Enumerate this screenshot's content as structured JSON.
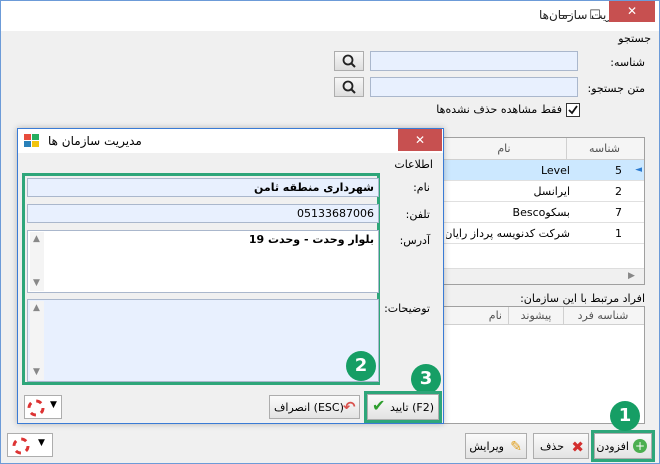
{
  "window": {
    "title": "مدیریت سازمان‌ها"
  },
  "search": {
    "group_title": "جستجو",
    "id_label": "شناسه:",
    "text_label": "متن جستجو:",
    "id_value": "",
    "text_value": "",
    "checkbox_label": "فقط مشاهده حذف نشده‌ها",
    "checkbox_checked": true
  },
  "grid": {
    "columns": {
      "id": "شناسه",
      "name": "نام"
    },
    "rows": [
      {
        "id": "5",
        "name": "Level"
      },
      {
        "id": "2",
        "name": "ایرانسل"
      },
      {
        "id": "7",
        "name": "بسکوBesco"
      },
      {
        "id": "1",
        "name": "شرکت کدنویسه پرداز رایان"
      }
    ]
  },
  "members": {
    "label": "افراد مرتبط با این سازمان:",
    "columns": {
      "person_id": "شناسه فرد",
      "prefix": "پیشوند",
      "name": "نام"
    }
  },
  "toolbar": {
    "add": "افزودن",
    "delete": "حذف",
    "edit": "ویرایش"
  },
  "dialog": {
    "title": "مدیریت سازمان ها",
    "group_title": "اطلاعات",
    "name_label": "نام:",
    "name_value": "شهرداری منطقه ثامن",
    "phone_label": "تلفن:",
    "phone_value": "05133687006",
    "address_label": "آدرس:",
    "address_value": "بلوار وحدت - وحدت 19",
    "notes_label": "توضیحات:",
    "notes_value": "",
    "confirm": "(F2) تایید",
    "cancel": "(ESC) انصراف"
  },
  "badges": [
    "1",
    "2",
    "3"
  ],
  "colors": {
    "accent_green": "#169e65",
    "close_red": "#c75050",
    "highlight_border": "#2ea67a"
  }
}
